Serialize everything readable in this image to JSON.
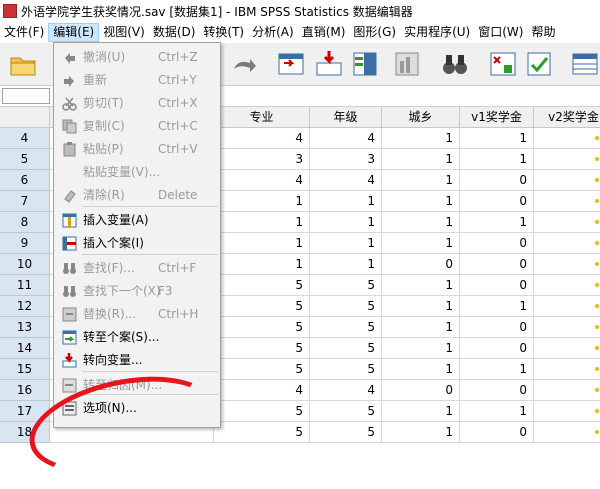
{
  "window": {
    "title": "外语学院学生获奖情况.sav [数据集1] - IBM SPSS Statistics 数据编辑器"
  },
  "menubar": {
    "items": [
      "文件(F)",
      "编辑(E)",
      "视图(V)",
      "数据(D)",
      "转换(T)",
      "分析(A)",
      "直销(M)",
      "图形(G)",
      "实用程序(U)",
      "窗口(W)",
      "帮助"
    ],
    "active_index": 1
  },
  "edit_menu": {
    "items": [
      {
        "label": "撤消(U)",
        "shortcut": "Ctrl+Z",
        "enabled": false,
        "icon": "undo-icon"
      },
      {
        "label": "重新",
        "shortcut": "Ctrl+Y",
        "enabled": false,
        "icon": "redo-icon"
      },
      {
        "label": "剪切(T)",
        "shortcut": "Ctrl+X",
        "enabled": false,
        "icon": "cut-icon"
      },
      {
        "label": "复制(C)",
        "shortcut": "Ctrl+C",
        "enabled": false,
        "icon": "copy-icon"
      },
      {
        "label": "粘贴(P)",
        "shortcut": "Ctrl+V",
        "enabled": false,
        "icon": "paste-icon"
      },
      {
        "label": "粘贴变量(V)...",
        "shortcut": "",
        "enabled": false,
        "icon": ""
      },
      {
        "label": "清除(R)",
        "shortcut": "Delete",
        "enabled": false,
        "icon": "clear-icon"
      },
      {
        "label": "插入变量(A)",
        "shortcut": "",
        "enabled": true,
        "icon": "insert-variable-icon"
      },
      {
        "label": "插入个案(I)",
        "shortcut": "",
        "enabled": true,
        "icon": "insert-case-icon"
      },
      {
        "label": "查找(F)...",
        "shortcut": "Ctrl+F",
        "enabled": false,
        "icon": "find-icon"
      },
      {
        "label": "查找下一个(X)",
        "shortcut": "F3",
        "enabled": false,
        "icon": "find-next-icon"
      },
      {
        "label": "替换(R)...",
        "shortcut": "Ctrl+H",
        "enabled": false,
        "icon": "replace-icon"
      },
      {
        "label": "转至个案(S)...",
        "shortcut": "",
        "enabled": true,
        "icon": "go-to-case-icon"
      },
      {
        "label": "转向变量...",
        "shortcut": "",
        "enabled": true,
        "icon": "go-to-variable-icon"
      },
      {
        "label": "转至归因(M)...",
        "shortcut": "",
        "enabled": false,
        "icon": "go-to-imputation-icon"
      },
      {
        "label": "选项(N)...",
        "shortcut": "",
        "enabled": true,
        "icon": "options-icon"
      }
    ]
  },
  "grid": {
    "columns": [
      "专业",
      "年级",
      "城乡",
      "v1奖学金",
      "v2奖学金"
    ],
    "rows": [
      {
        "num": "4",
        "values": [
          "4",
          "4",
          "1",
          "1",
          ""
        ]
      },
      {
        "num": "5",
        "values": [
          "3",
          "3",
          "1",
          "1",
          ""
        ]
      },
      {
        "num": "6",
        "values": [
          "4",
          "4",
          "1",
          "0",
          ""
        ]
      },
      {
        "num": "7",
        "values": [
          "1",
          "1",
          "1",
          "0",
          ""
        ]
      },
      {
        "num": "8",
        "values": [
          "1",
          "1",
          "1",
          "1",
          ""
        ]
      },
      {
        "num": "9",
        "values": [
          "1",
          "1",
          "1",
          "0",
          ""
        ]
      },
      {
        "num": "10",
        "values": [
          "1",
          "1",
          "0",
          "0",
          ""
        ]
      },
      {
        "num": "11",
        "values": [
          "5",
          "5",
          "1",
          "0",
          ""
        ]
      },
      {
        "num": "12",
        "values": [
          "5",
          "5",
          "1",
          "1",
          ""
        ]
      },
      {
        "num": "13",
        "values": [
          "5",
          "5",
          "1",
          "0",
          ""
        ]
      },
      {
        "num": "14",
        "values": [
          "5",
          "5",
          "1",
          "0",
          ""
        ]
      },
      {
        "num": "15",
        "values": [
          "5",
          "5",
          "1",
          "1",
          ""
        ]
      },
      {
        "num": "16",
        "values": [
          "4",
          "4",
          "0",
          "0",
          ""
        ]
      },
      {
        "num": "17",
        "values": [
          "5",
          "5",
          "1",
          "1",
          ""
        ]
      },
      {
        "num": "18",
        "values": [
          "5",
          "5",
          "1",
          "0",
          ""
        ]
      }
    ]
  },
  "colors": {
    "menu_highlight": "#cce8ff",
    "annotation_circle": "#e8141b"
  }
}
